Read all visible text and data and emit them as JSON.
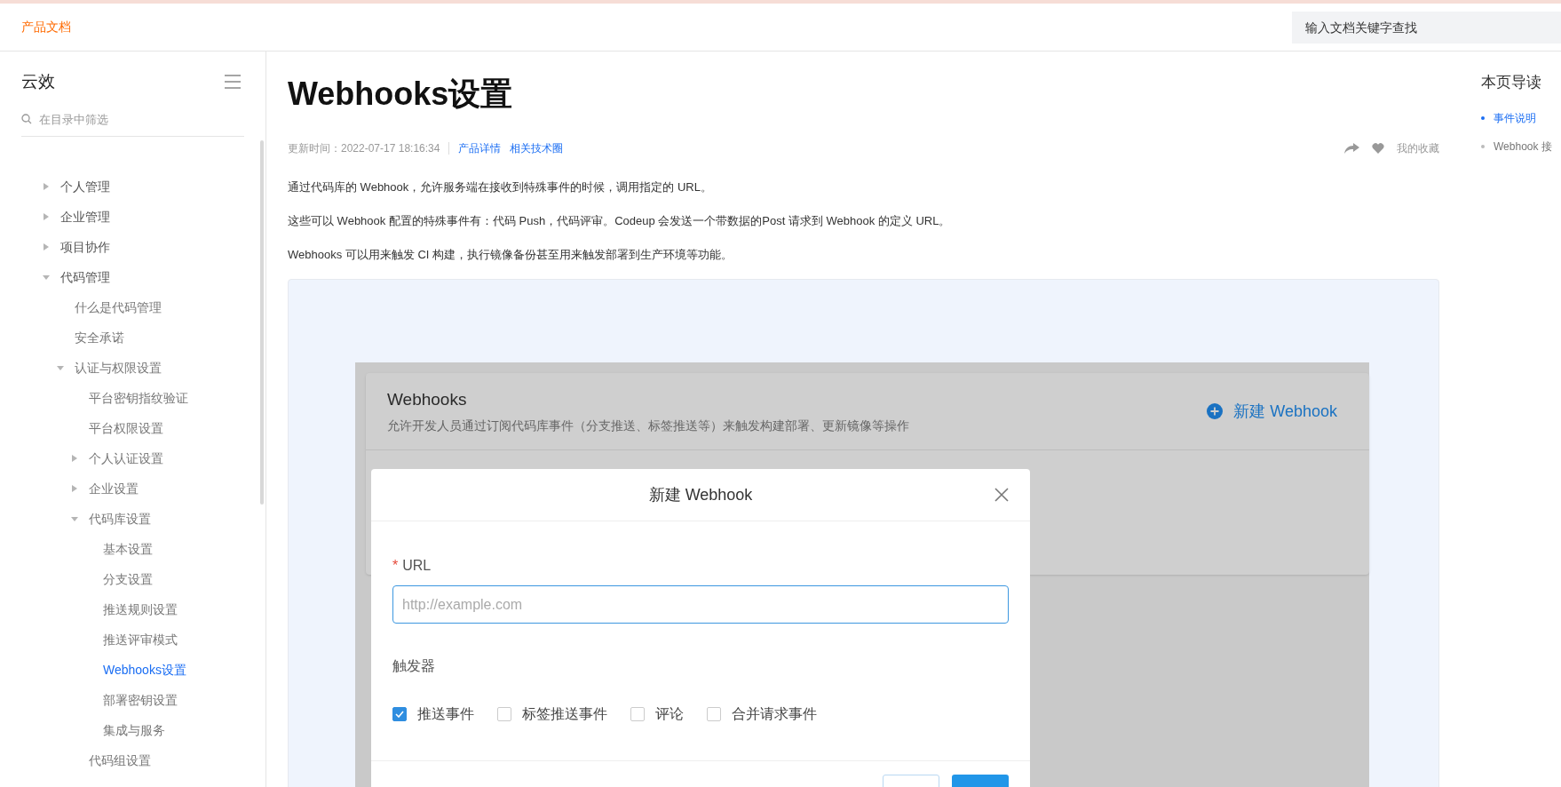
{
  "header": {
    "brand": "产品文档",
    "search": {
      "placeholder": "输入文档关键字查找"
    }
  },
  "sidebar": {
    "title": "云效",
    "filter": {
      "placeholder": "在目录中筛选"
    },
    "items": [
      {
        "label": "个人管理",
        "expanded": false,
        "selected": false
      },
      {
        "label": "企业管理",
        "expanded": false,
        "selected": false
      },
      {
        "label": "项目协作",
        "expanded": false,
        "selected": false
      },
      {
        "label": "代码管理",
        "expanded": true,
        "selected": false,
        "children": [
          {
            "label": "什么是代码管理",
            "selected": false
          },
          {
            "label": "安全承诺",
            "selected": false
          },
          {
            "label": "认证与权限设置",
            "expanded": true,
            "selected": false,
            "children": [
              {
                "label": "平台密钥指纹验证",
                "selected": false
              },
              {
                "label": "平台权限设置",
                "selected": false
              },
              {
                "label": "个人认证设置",
                "expanded": false,
                "selected": false
              },
              {
                "label": "企业设置",
                "expanded": false,
                "selected": false
              },
              {
                "label": "代码库设置",
                "expanded": true,
                "selected": false,
                "children": [
                  {
                    "label": "基本设置",
                    "selected": false
                  },
                  {
                    "label": "分支设置",
                    "selected": false
                  },
                  {
                    "label": "推送规则设置",
                    "selected": false
                  },
                  {
                    "label": "推送评审模式",
                    "selected": false
                  },
                  {
                    "label": "Webhooks设置",
                    "selected": true
                  },
                  {
                    "label": "部署密钥设置",
                    "selected": false
                  },
                  {
                    "label": "集成与服务",
                    "selected": false
                  }
                ]
              },
              {
                "label": "代码组设置",
                "selected": false
              }
            ]
          }
        ]
      }
    ]
  },
  "article": {
    "title": "Webhooks设置",
    "updated": "更新时间：2022-07-17 18:16:34",
    "links": [
      "产品详情",
      "相关技术圈"
    ],
    "favorite_label": "我的收藏",
    "paragraphs": [
      "通过代码库的 Webhook，允许服务端在接收到特殊事件的时候，调用指定的 URL。",
      "这些可以 Webhook 配置的特殊事件有：代码 Push，代码评审。Codeup 会发送一个带数据的Post 请求到 Webhook 的定义 URL。",
      "Webhooks 可以用来触发 CI 构建，执行镜像备份甚至用来触发部署到生产环境等功能。"
    ],
    "figure": {
      "card": {
        "title": "Webhooks",
        "description": "允许开发人员通过订阅代码库事件（分支推送、标签推送等）来触发构建部署、更新镜像等操作",
        "action": "新建 Webhook"
      },
      "dialog": {
        "title": "新建 Webhook",
        "url_field": {
          "label": "URL",
          "required": true,
          "required_mark": "*",
          "placeholder": "http://example.com"
        },
        "trigger_label": "触发器",
        "triggers": [
          {
            "label": "推送事件",
            "checked": true
          },
          {
            "label": "标签推送事件",
            "checked": false
          },
          {
            "label": "评论",
            "checked": false
          },
          {
            "label": "合并请求事件",
            "checked": false
          }
        ]
      }
    }
  },
  "toc": {
    "title": "本页导读",
    "items": [
      {
        "label": "事件说明",
        "selected": true
      },
      {
        "label": "Webhook 接",
        "selected": false
      }
    ]
  }
}
